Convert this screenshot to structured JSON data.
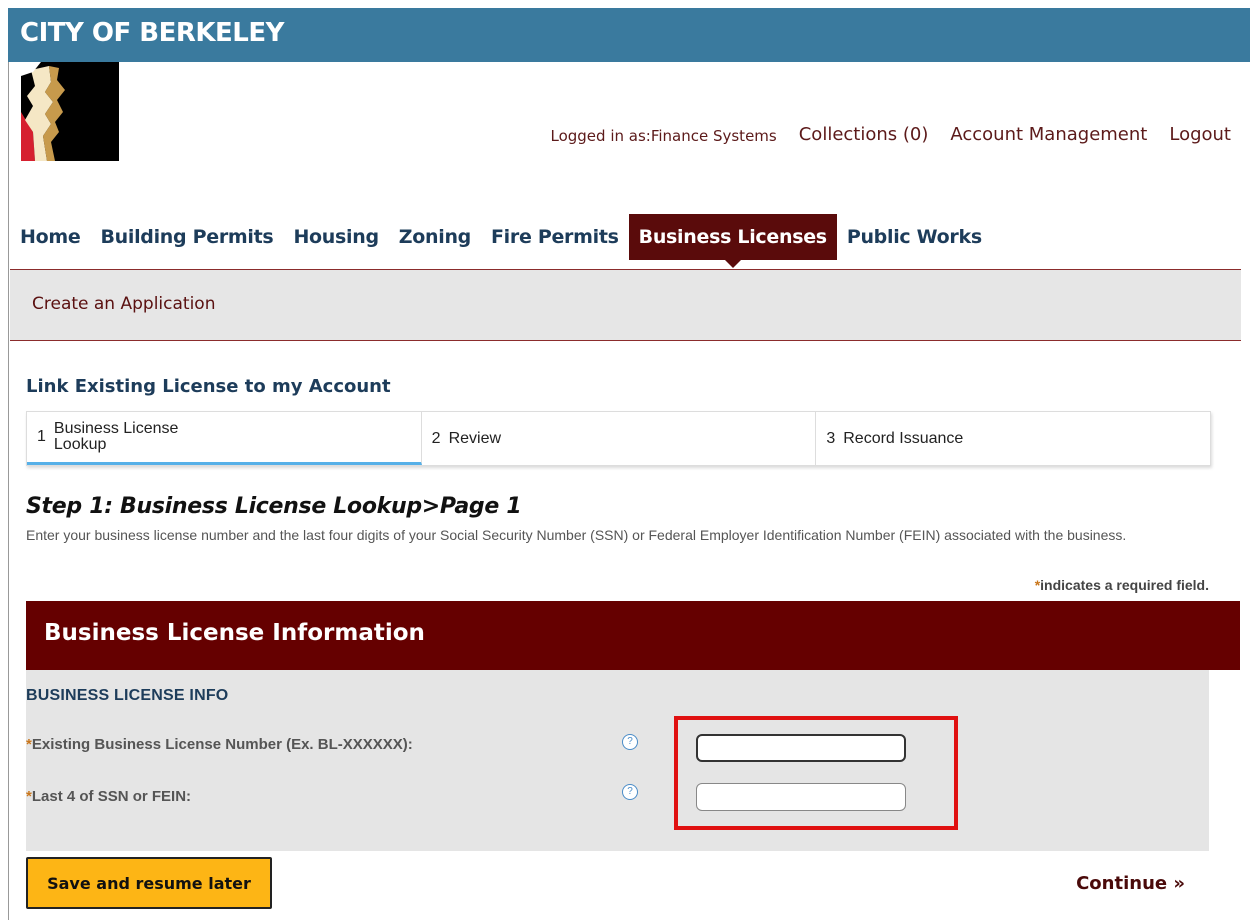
{
  "header": {
    "city_name": "CITY OF BERKELEY"
  },
  "account": {
    "logged_in": "Logged in as:Finance Systems",
    "collections": "Collections (0)",
    "account_management": "Account Management",
    "logout": "Logout"
  },
  "nav": {
    "items": [
      "Home",
      "Building Permits",
      "Housing",
      "Zoning",
      "Fire Permits",
      "Business Licenses",
      "Public Works"
    ],
    "active": "Business Licenses"
  },
  "subnav": {
    "create_application": "Create an Application"
  },
  "page": {
    "link_title": "Link Existing License to my Account",
    "steps": [
      {
        "number": "1",
        "label": "Business License Lookup"
      },
      {
        "number": "2",
        "label": "Review"
      },
      {
        "number": "3",
        "label": "Record Issuance"
      }
    ],
    "step_heading": "Step 1: Business License Lookup>Page 1",
    "description": "Enter your business license number and the last four digits of your Social Security Number (SSN) or Federal Employer Identification Number (FEIN) associated with the business.",
    "required_star": "*",
    "required_note": "indicates a required field."
  },
  "form": {
    "panel_title": "Business License Information",
    "section_title": "BUSINESS LICENSE INFO",
    "fields": [
      {
        "label": "Existing Business License Number (Ex. BL-XXXXXX):",
        "value": ""
      },
      {
        "label": "Last 4 of SSN or FEIN:",
        "value": ""
      }
    ],
    "help_glyph": "?"
  },
  "actions": {
    "save": "Save and resume later",
    "continue": "Continue »"
  },
  "colors": {
    "topbar": "#3a7a9e",
    "maroon": "#650000",
    "save_button": "#fdb515",
    "highlight": "#e01010"
  }
}
